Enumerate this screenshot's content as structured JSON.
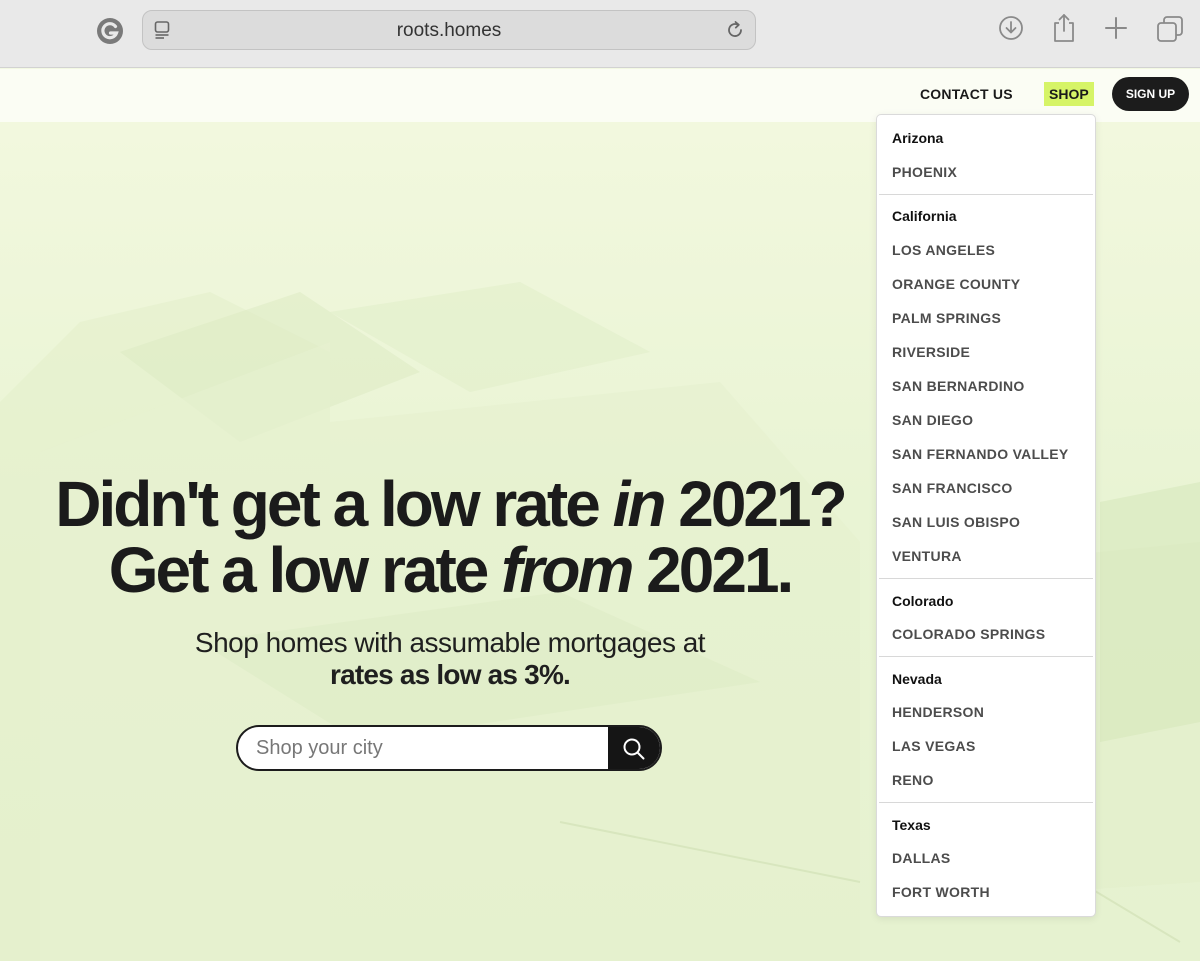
{
  "browser": {
    "url": "roots.homes"
  },
  "nav": {
    "contact": "CONTACT US",
    "shop": "SHOP",
    "signup": "SIGN UP"
  },
  "hero": {
    "line1_pre": "Didn't get a low rate ",
    "line1_em": "in",
    "line1_post": " 2021?",
    "line2_pre": "Get a low rate ",
    "line2_em": "from",
    "line2_post": " 2021.",
    "sub_line1": "Shop homes with assumable mortgages at",
    "sub_line2": "rates as low as 3%."
  },
  "search": {
    "placeholder": "Shop your city"
  },
  "dropdown": {
    "groups": [
      {
        "state": "Arizona",
        "cities": [
          "PHOENIX"
        ]
      },
      {
        "state": "California",
        "cities": [
          "LOS ANGELES",
          "ORANGE COUNTY",
          "PALM SPRINGS",
          "RIVERSIDE",
          "SAN BERNARDINO",
          "SAN DIEGO",
          "SAN FERNANDO VALLEY",
          "SAN FRANCISCO",
          "SAN LUIS OBISPO",
          "VENTURA"
        ]
      },
      {
        "state": "Colorado",
        "cities": [
          "COLORADO SPRINGS"
        ]
      },
      {
        "state": "Nevada",
        "cities": [
          "HENDERSON",
          "LAS VEGAS",
          "RENO"
        ]
      },
      {
        "state": "Texas",
        "cities": [
          "DALLAS",
          "FORT WORTH"
        ]
      }
    ]
  },
  "icons": {
    "app": "grammarly-icon",
    "page": "page-icon",
    "reload": "reload-icon",
    "download": "download-icon",
    "share": "share-icon",
    "new_tab": "plus-icon",
    "tabs": "tabs-icon",
    "search": "search-icon"
  },
  "colors": {
    "accent": "#d6f467",
    "dark": "#1c1c1c",
    "hero_bg": "#eaf5d6"
  }
}
